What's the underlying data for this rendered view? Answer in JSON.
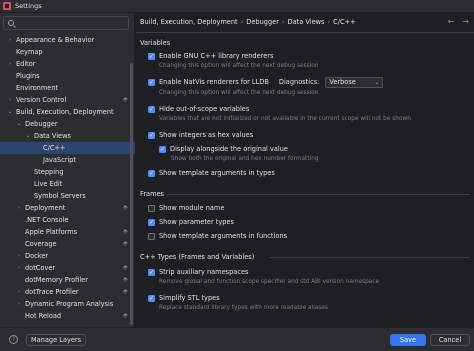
{
  "window": {
    "title": "Settings"
  },
  "sidebar": {
    "search_placeholder": "",
    "items": [
      {
        "label": "Appearance & Behavior",
        "arrow": "›",
        "project": false
      },
      {
        "label": "Keymap",
        "arrow": "",
        "project": false
      },
      {
        "label": "Editor",
        "arrow": "›",
        "project": false
      },
      {
        "label": "Plugins",
        "arrow": "",
        "project": false
      },
      {
        "label": "Environment",
        "arrow": "",
        "project": false
      },
      {
        "label": "Version Control",
        "arrow": "›",
        "project": true
      },
      {
        "label": "Build, Execution, Deployment",
        "arrow": "⌄",
        "project": false
      },
      {
        "label": "Debugger",
        "arrow": "⌄",
        "project": false
      },
      {
        "label": "Data Views",
        "arrow": "⌄",
        "project": false
      },
      {
        "label": "C/C++",
        "arrow": "",
        "project": false,
        "selected": true
      },
      {
        "label": "JavaScript",
        "arrow": "",
        "project": false
      },
      {
        "label": "Stepping",
        "arrow": "",
        "project": false
      },
      {
        "label": "Live Edit",
        "arrow": "",
        "project": false
      },
      {
        "label": "Symbol Servers",
        "arrow": "",
        "project": false
      },
      {
        "label": "Deployment",
        "arrow": "›",
        "project": true
      },
      {
        "label": ".NET Console",
        "arrow": "",
        "project": false
      },
      {
        "label": "Apple Platforms",
        "arrow": "",
        "project": true
      },
      {
        "label": "Coverage",
        "arrow": "",
        "project": true
      },
      {
        "label": "Docker",
        "arrow": "›",
        "project": false
      },
      {
        "label": "dotCover",
        "arrow": "›",
        "project": true
      },
      {
        "label": "dotMemory Profiler",
        "arrow": "",
        "project": true
      },
      {
        "label": "dotTrace Profiler",
        "arrow": "›",
        "project": true
      },
      {
        "label": "Dynamic Program Analysis",
        "arrow": "›",
        "project": false
      },
      {
        "label": "Hot Reload",
        "arrow": "",
        "project": true
      }
    ]
  },
  "breadcrumb": [
    "Build, Execution, Deployment",
    "Debugger",
    "Data Views",
    "C/C++"
  ],
  "sections": {
    "variables": "Variables",
    "frames": "Frames",
    "cpp_types": "C++ Types (Frames and Variables)"
  },
  "options": {
    "gnu_renderers": {
      "label": "Enable GNU C++ library renderers",
      "checked": true,
      "hint": "Changing this option will affect the next debug session"
    },
    "natvis": {
      "label": "Enable NatVis renderers for LLDB",
      "checked": true,
      "hint": "Changing this option will affect the next debug session",
      "diagnostics_label": "Diagnostics:",
      "diagnostics_value": "Verbose"
    },
    "out_of_scope": {
      "label": "Hide out-of-scope variables",
      "checked": true,
      "hint": "Variables that are not initialized or not available in the current scope will not be shown"
    },
    "integers_hex": {
      "label": "Show integers as hex values",
      "checked": true
    },
    "display_original": {
      "label": "Display alongside the original value",
      "checked": true,
      "hint": "Show both the original and hex number formatting"
    },
    "template_args_types": {
      "label": "Show template arguments in types",
      "checked": true
    },
    "module_name": {
      "label": "Show module name",
      "checked": false
    },
    "parameter_types": {
      "label": "Show parameter types",
      "checked": true
    },
    "template_args_functions": {
      "label": "Show template arguments in functions",
      "checked": false
    },
    "strip_namespaces": {
      "label": "Strip auxiliary namespaces",
      "checked": true,
      "hint": "Remove global and function scope specifier and std ABI version namespace"
    },
    "simplify_stl": {
      "label": "Simplify STL types",
      "checked": true,
      "hint": "Replace standard library types with more readable aliases"
    }
  },
  "footer": {
    "help": "?",
    "manage_layers": "Manage Layers",
    "save": "Save",
    "cancel": "Cancel"
  },
  "colors": {
    "accent": "#3574f0",
    "checkbox": "#548af7",
    "selection": "#2e436e"
  }
}
